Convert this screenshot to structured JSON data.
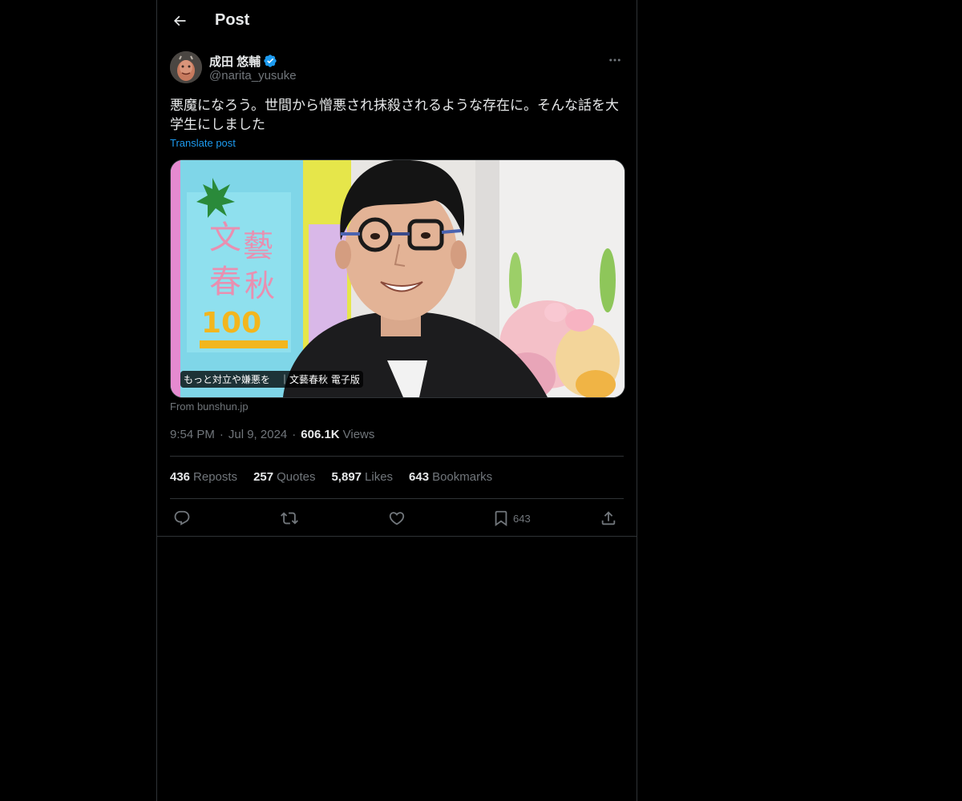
{
  "header": {
    "title": "Post"
  },
  "author": {
    "name": "成田 悠輔",
    "handle": "@narita_yusuke",
    "verified": true
  },
  "post": {
    "text": "悪魔になろう。世間から憎悪され抹殺されるような存在に。そんな話を大学生にしました",
    "translate_label": "Translate post"
  },
  "card": {
    "caption": "もっと対立や嫌悪を　｜文藝春秋 電子版",
    "source": "From bunshun.jp"
  },
  "meta": {
    "time": "9:54 PM",
    "date": "Jul 9, 2024",
    "views_count": "606.1K",
    "views_label": "Views"
  },
  "stats": [
    {
      "count": "436",
      "label": "Reposts"
    },
    {
      "count": "257",
      "label": "Quotes"
    },
    {
      "count": "5,897",
      "label": "Likes"
    },
    {
      "count": "643",
      "label": "Bookmarks"
    }
  ],
  "actions": {
    "bookmark_count": "643"
  },
  "icons": {
    "back": "back-arrow-icon",
    "more": "more-dots-icon",
    "verified": "verified-badge-icon",
    "reply": "reply-icon",
    "repost": "repost-icon",
    "like": "heart-icon",
    "bookmark": "bookmark-icon",
    "share": "share-icon"
  },
  "colors": {
    "background": "#000000",
    "text": "#e7e9ea",
    "secondary": "#71767b",
    "accent": "#1d9bf0",
    "border": "#2f3336"
  }
}
